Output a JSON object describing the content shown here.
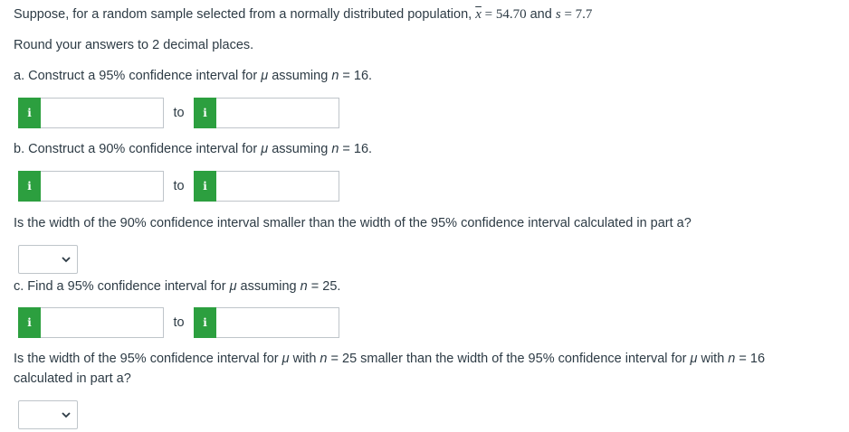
{
  "intro": {
    "text": "Suppose, for a random sample selected from a normally distributed population,",
    "xbar_symbol": "x",
    "eq1": " = 54.70",
    "and": " and ",
    "s_symbol": "s",
    "eq2": " = 7.7"
  },
  "round_note": "Round your answers to 2 decimal places.",
  "part_a": {
    "prefix": "a. Construct a 95% confidence interval for ",
    "mu": "μ",
    "mid": " assuming ",
    "n": "n",
    "suffix": " = 16.",
    "to_label": "to",
    "lower_value": "",
    "upper_value": ""
  },
  "part_b": {
    "prefix": "b. Construct a 90% confidence interval for ",
    "mu": "μ",
    "mid": " assuming ",
    "n": "n",
    "suffix": " = 16.",
    "to_label": "to",
    "lower_value": "",
    "upper_value": ""
  },
  "question_1": "Is the width of the 90% confidence interval smaller than the width of the 95% confidence interval calculated in part a?",
  "select_1_value": "",
  "part_c": {
    "prefix": "c. Find a 95% confidence interval for ",
    "mu": "μ",
    "mid": " assuming ",
    "n": "n",
    "suffix": " = 25.",
    "to_label": "to",
    "lower_value": "",
    "upper_value": ""
  },
  "question_2": {
    "p1": "Is the width of the 95% confidence interval for ",
    "mu1": "μ",
    "p2": " with ",
    "n1": "n",
    "p3": " = 25 smaller than the width of the 95% confidence interval for ",
    "mu2": "μ",
    "p4": " with ",
    "n2": "n",
    "p5": " = 16",
    "line2": "calculated in part a?"
  },
  "select_2_value": "",
  "info_icon_glyph": "i",
  "colors": {
    "info_green": "#2c9f3f",
    "text": "#2d3b45",
    "border": "#bfc5ca"
  },
  "icons": {
    "info": "info-icon",
    "dropdown": "chevron-down-icon"
  }
}
